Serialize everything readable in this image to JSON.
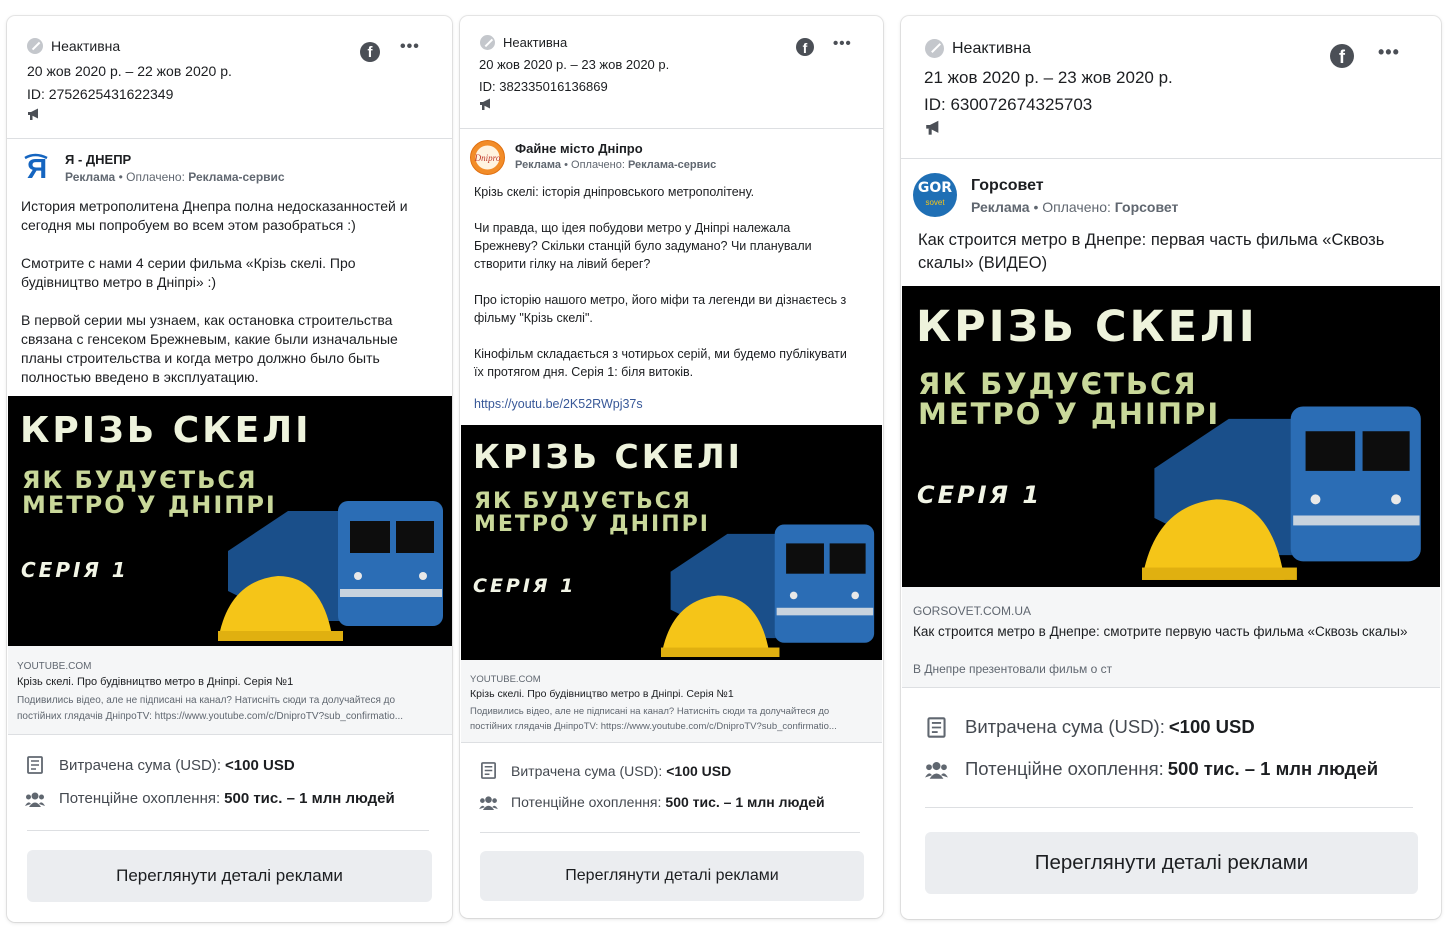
{
  "colors": {
    "accent": "#385898",
    "muted": "#606770",
    "button_bg": "#ebedf0",
    "status_dot": "#c4c7cc"
  },
  "icons": {
    "status": "inactive-status-icon",
    "platform": "facebook-icon",
    "menu": "more-options-icon",
    "placement": "megaphone-icon",
    "spend": "receipt-icon",
    "reach": "people-icon"
  },
  "cards": [
    {
      "status": "Неактивна",
      "dates": "20 жов 2020 р. – 22 жов 2020 р.",
      "id": "ID: 2752625431622349",
      "page_name": "Я - ДНЕПР",
      "sponsored": "Реклама",
      "paid_prefix": "• Оплачено:",
      "paid_by": "Реклама-сервис",
      "text": "История метрополитена Днепра полна недосказанностей и сегодня мы попробуем во всем этом разобраться :)\n\nСмотрите с нами 4 серии фильма «Крізь скелі. Про будівництво метро в Дніпрі» :)\n\nВ первой серии мы узнаем, как остановка строительства связана с генсеком Брежневым, какие были изначальные планы строительства и когда метро должно было быть полностью введено в эксплуатацию.",
      "link_text": "",
      "creative": {
        "title": "КРІЗЬ СКЕЛІ",
        "subtitle": "ЯК БУДУЄТЬСЯ\nМЕТРО У ДНІПРІ",
        "series": "СЕРІЯ 1"
      },
      "link_domain": "YOUTUBE.COM",
      "link_title": "Крізь скелі. Про будівництво метро в Дніпрі. Серія №1",
      "link_desc": "Подивились відео, але не підписані на канал? Натисніть сюди та долучайтеся до постійних глядачів ДніпроTV: https://www.youtube.com/c/DniproTV?sub_confirmatio...",
      "spend_label": "Витрачена сума (USD):",
      "spend_value": "<100 USD",
      "reach_label": "Потенційне охоплення:",
      "reach_value": "500 тис. – 1 млн людей",
      "button": "Переглянути деталі реклами"
    },
    {
      "status": "Неактивна",
      "dates": "20 жов 2020 р. – 23 жов 2020 р.",
      "id": "ID: 382335016136869",
      "page_name": "Файне місто Дніпро",
      "sponsored": "Реклама",
      "paid_prefix": "• Оплачено:",
      "paid_by": "Реклама-сервис",
      "text": "Крізь скелі: історія дніпровського метрополітену.\n\nЧи правда, що ідея побудови метро у Дніпрі належала Брежневу? Скільки станцій було задумано? Чи планували створити гілку на лівий берег?\n\nПро історію нашого метро, його міфи та легенди ви дізнаєтесь з фільму \"Крізь скелі\".\n\nКінофільм складається з чотирьох серій, ми будемо публікувати їх протягом дня. Серія 1: біля витоків.",
      "link_text": "https://youtu.be/2K52RWpj37s",
      "creative": {
        "title": "КРІЗЬ СКЕЛІ",
        "subtitle": "ЯК БУДУЄТЬСЯ\nМЕТРО У ДНІПРІ",
        "series": "СЕРІЯ 1"
      },
      "link_domain": "YOUTUBE.COM",
      "link_title": "Крізь скелі. Про будівництво метро в Дніпрі. Серія №1",
      "link_desc": "Подивились відео, але не підписані на канал? Натисніть сюди та долучайтеся до постійних глядачів ДніпроTV: https://www.youtube.com/c/DniproTV?sub_confirmatio...",
      "spend_label": "Витрачена сума (USD):",
      "spend_value": "<100 USD",
      "reach_label": "Потенційне охоплення:",
      "reach_value": "500 тис. – 1 млн людей",
      "button": "Переглянути деталі реклами"
    },
    {
      "status": "Неактивна",
      "dates": "21 жов 2020 р. – 23 жов 2020 р.",
      "id": "ID: 630072674325703",
      "page_name": "Горсовет",
      "sponsored": "Реклама",
      "paid_prefix": "• Оплачено:",
      "paid_by": "Горсовет",
      "avatar_text": "GOR",
      "avatar_sub": "sovet",
      "text": "Как строится метро в Днепре: первая часть фильма «Сквозь скалы» (ВИДЕО)",
      "link_text": "",
      "creative": {
        "title": "КРІЗЬ СКЕЛІ",
        "subtitle": "ЯК БУДУЄТЬСЯ\nМЕТРО У ДНІПРІ",
        "series": "СЕРІЯ 1"
      },
      "link_domain": "GORSOVET.COM.UA",
      "link_title": "Как строится метро в Днепре: смотрите первую часть фильма «Сквозь скалы»",
      "link_desc": "В Днепре презентовали фильм о ст",
      "spend_label": "Витрачена сума (USD):",
      "spend_value": "<100 USD",
      "reach_label": "Потенційне охоплення:",
      "reach_value": "500 тис. – 1 млн людей",
      "button": "Переглянути деталі реклами"
    }
  ]
}
